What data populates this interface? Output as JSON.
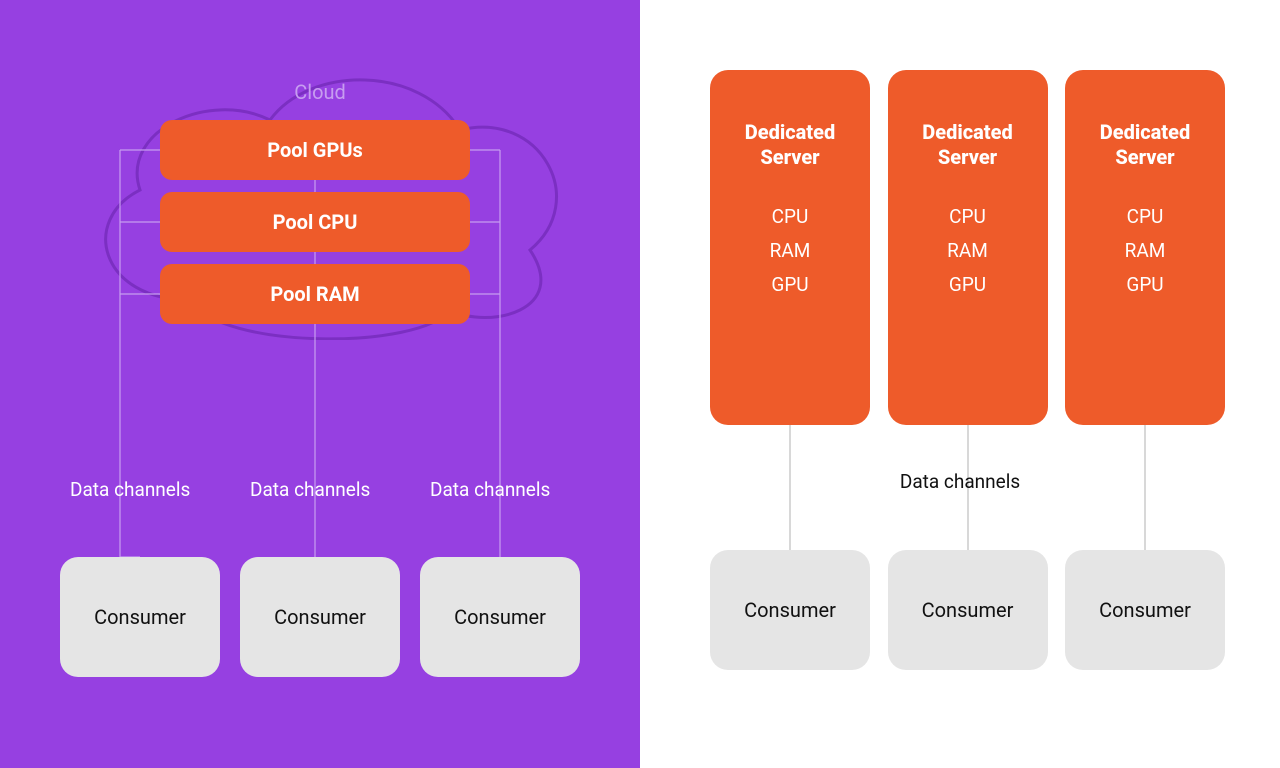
{
  "colors": {
    "purple": "#9640E1",
    "orange": "#EE5B2A",
    "grey": "#E5E5E5",
    "cloud_stroke": "#7B2FC2"
  },
  "left": {
    "cloud_label": "Cloud",
    "pools": [
      {
        "label": "Pool GPUs"
      },
      {
        "label": "Pool CPU"
      },
      {
        "label": "Pool RAM"
      }
    ],
    "channels": [
      {
        "label": "Data channels"
      },
      {
        "label": "Data channels"
      },
      {
        "label": "Data channels"
      }
    ],
    "consumers": [
      {
        "label": "Consumer"
      },
      {
        "label": "Consumer"
      },
      {
        "label": "Consumer"
      }
    ]
  },
  "right": {
    "servers": [
      {
        "title_line1": "Dedicated",
        "title_line2": "Server",
        "spec1": "CPU",
        "spec2": "RAM",
        "spec3": "GPU"
      },
      {
        "title_line1": "Dedicated",
        "title_line2": "Server",
        "spec1": "CPU",
        "spec2": "RAM",
        "spec3": "GPU"
      },
      {
        "title_line1": "Dedicated",
        "title_line2": "Server",
        "spec1": "CPU",
        "spec2": "RAM",
        "spec3": "GPU"
      }
    ],
    "channel_label": "Data channels",
    "consumers": [
      {
        "label": "Consumer"
      },
      {
        "label": "Consumer"
      },
      {
        "label": "Consumer"
      }
    ]
  }
}
